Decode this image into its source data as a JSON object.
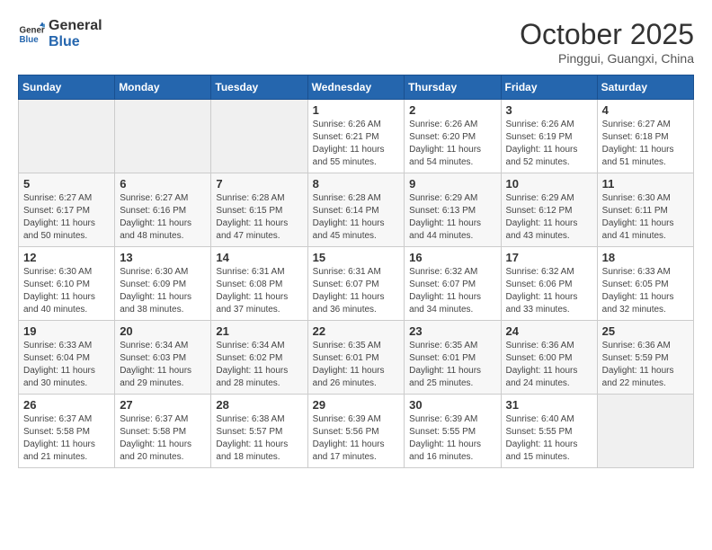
{
  "header": {
    "logo_line1": "General",
    "logo_line2": "Blue",
    "month": "October 2025",
    "location": "Pinggui, Guangxi, China"
  },
  "weekdays": [
    "Sunday",
    "Monday",
    "Tuesday",
    "Wednesday",
    "Thursday",
    "Friday",
    "Saturday"
  ],
  "weeks": [
    [
      {
        "day": "",
        "info": ""
      },
      {
        "day": "",
        "info": ""
      },
      {
        "day": "",
        "info": ""
      },
      {
        "day": "1",
        "info": "Sunrise: 6:26 AM\nSunset: 6:21 PM\nDaylight: 11 hours\nand 55 minutes."
      },
      {
        "day": "2",
        "info": "Sunrise: 6:26 AM\nSunset: 6:20 PM\nDaylight: 11 hours\nand 54 minutes."
      },
      {
        "day": "3",
        "info": "Sunrise: 6:26 AM\nSunset: 6:19 PM\nDaylight: 11 hours\nand 52 minutes."
      },
      {
        "day": "4",
        "info": "Sunrise: 6:27 AM\nSunset: 6:18 PM\nDaylight: 11 hours\nand 51 minutes."
      }
    ],
    [
      {
        "day": "5",
        "info": "Sunrise: 6:27 AM\nSunset: 6:17 PM\nDaylight: 11 hours\nand 50 minutes."
      },
      {
        "day": "6",
        "info": "Sunrise: 6:27 AM\nSunset: 6:16 PM\nDaylight: 11 hours\nand 48 minutes."
      },
      {
        "day": "7",
        "info": "Sunrise: 6:28 AM\nSunset: 6:15 PM\nDaylight: 11 hours\nand 47 minutes."
      },
      {
        "day": "8",
        "info": "Sunrise: 6:28 AM\nSunset: 6:14 PM\nDaylight: 11 hours\nand 45 minutes."
      },
      {
        "day": "9",
        "info": "Sunrise: 6:29 AM\nSunset: 6:13 PM\nDaylight: 11 hours\nand 44 minutes."
      },
      {
        "day": "10",
        "info": "Sunrise: 6:29 AM\nSunset: 6:12 PM\nDaylight: 11 hours\nand 43 minutes."
      },
      {
        "day": "11",
        "info": "Sunrise: 6:30 AM\nSunset: 6:11 PM\nDaylight: 11 hours\nand 41 minutes."
      }
    ],
    [
      {
        "day": "12",
        "info": "Sunrise: 6:30 AM\nSunset: 6:10 PM\nDaylight: 11 hours\nand 40 minutes."
      },
      {
        "day": "13",
        "info": "Sunrise: 6:30 AM\nSunset: 6:09 PM\nDaylight: 11 hours\nand 38 minutes."
      },
      {
        "day": "14",
        "info": "Sunrise: 6:31 AM\nSunset: 6:08 PM\nDaylight: 11 hours\nand 37 minutes."
      },
      {
        "day": "15",
        "info": "Sunrise: 6:31 AM\nSunset: 6:07 PM\nDaylight: 11 hours\nand 36 minutes."
      },
      {
        "day": "16",
        "info": "Sunrise: 6:32 AM\nSunset: 6:07 PM\nDaylight: 11 hours\nand 34 minutes."
      },
      {
        "day": "17",
        "info": "Sunrise: 6:32 AM\nSunset: 6:06 PM\nDaylight: 11 hours\nand 33 minutes."
      },
      {
        "day": "18",
        "info": "Sunrise: 6:33 AM\nSunset: 6:05 PM\nDaylight: 11 hours\nand 32 minutes."
      }
    ],
    [
      {
        "day": "19",
        "info": "Sunrise: 6:33 AM\nSunset: 6:04 PM\nDaylight: 11 hours\nand 30 minutes."
      },
      {
        "day": "20",
        "info": "Sunrise: 6:34 AM\nSunset: 6:03 PM\nDaylight: 11 hours\nand 29 minutes."
      },
      {
        "day": "21",
        "info": "Sunrise: 6:34 AM\nSunset: 6:02 PM\nDaylight: 11 hours\nand 28 minutes."
      },
      {
        "day": "22",
        "info": "Sunrise: 6:35 AM\nSunset: 6:01 PM\nDaylight: 11 hours\nand 26 minutes."
      },
      {
        "day": "23",
        "info": "Sunrise: 6:35 AM\nSunset: 6:01 PM\nDaylight: 11 hours\nand 25 minutes."
      },
      {
        "day": "24",
        "info": "Sunrise: 6:36 AM\nSunset: 6:00 PM\nDaylight: 11 hours\nand 24 minutes."
      },
      {
        "day": "25",
        "info": "Sunrise: 6:36 AM\nSunset: 5:59 PM\nDaylight: 11 hours\nand 22 minutes."
      }
    ],
    [
      {
        "day": "26",
        "info": "Sunrise: 6:37 AM\nSunset: 5:58 PM\nDaylight: 11 hours\nand 21 minutes."
      },
      {
        "day": "27",
        "info": "Sunrise: 6:37 AM\nSunset: 5:58 PM\nDaylight: 11 hours\nand 20 minutes."
      },
      {
        "day": "28",
        "info": "Sunrise: 6:38 AM\nSunset: 5:57 PM\nDaylight: 11 hours\nand 18 minutes."
      },
      {
        "day": "29",
        "info": "Sunrise: 6:39 AM\nSunset: 5:56 PM\nDaylight: 11 hours\nand 17 minutes."
      },
      {
        "day": "30",
        "info": "Sunrise: 6:39 AM\nSunset: 5:55 PM\nDaylight: 11 hours\nand 16 minutes."
      },
      {
        "day": "31",
        "info": "Sunrise: 6:40 AM\nSunset: 5:55 PM\nDaylight: 11 hours\nand 15 minutes."
      },
      {
        "day": "",
        "info": ""
      }
    ]
  ]
}
